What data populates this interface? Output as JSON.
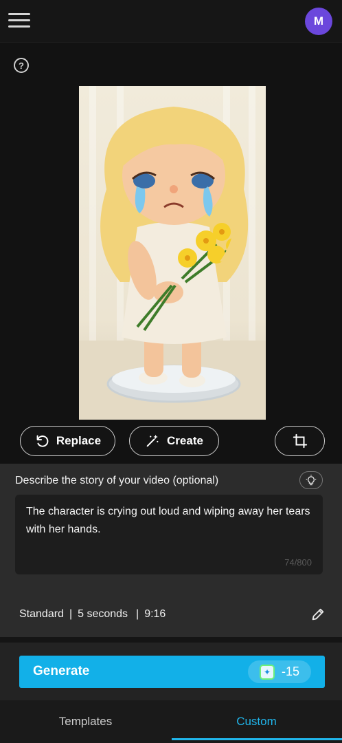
{
  "header": {
    "avatar_initial": "M",
    "avatar_color": "#6b47dc"
  },
  "main": {
    "help_symbol": "?",
    "image_subject": "crying-doll-figurine-with-yellow-flowers",
    "actions": {
      "replace_label": "Replace",
      "create_label": "Create"
    }
  },
  "story": {
    "label": "Describe the story of your video (optional)",
    "text": "The character is crying out loud and wiping away her tears with her hands.",
    "counter": "74/800",
    "settings": {
      "quality": "Standard",
      "duration": "5 seconds",
      "ratio": "9:16"
    }
  },
  "generate": {
    "label": "Generate",
    "cost": "-15",
    "accent": "#12b0e8"
  },
  "nav": {
    "tabs": [
      {
        "label": "Templates"
      },
      {
        "label": "Custom"
      }
    ],
    "active_color": "#20b6ec"
  }
}
